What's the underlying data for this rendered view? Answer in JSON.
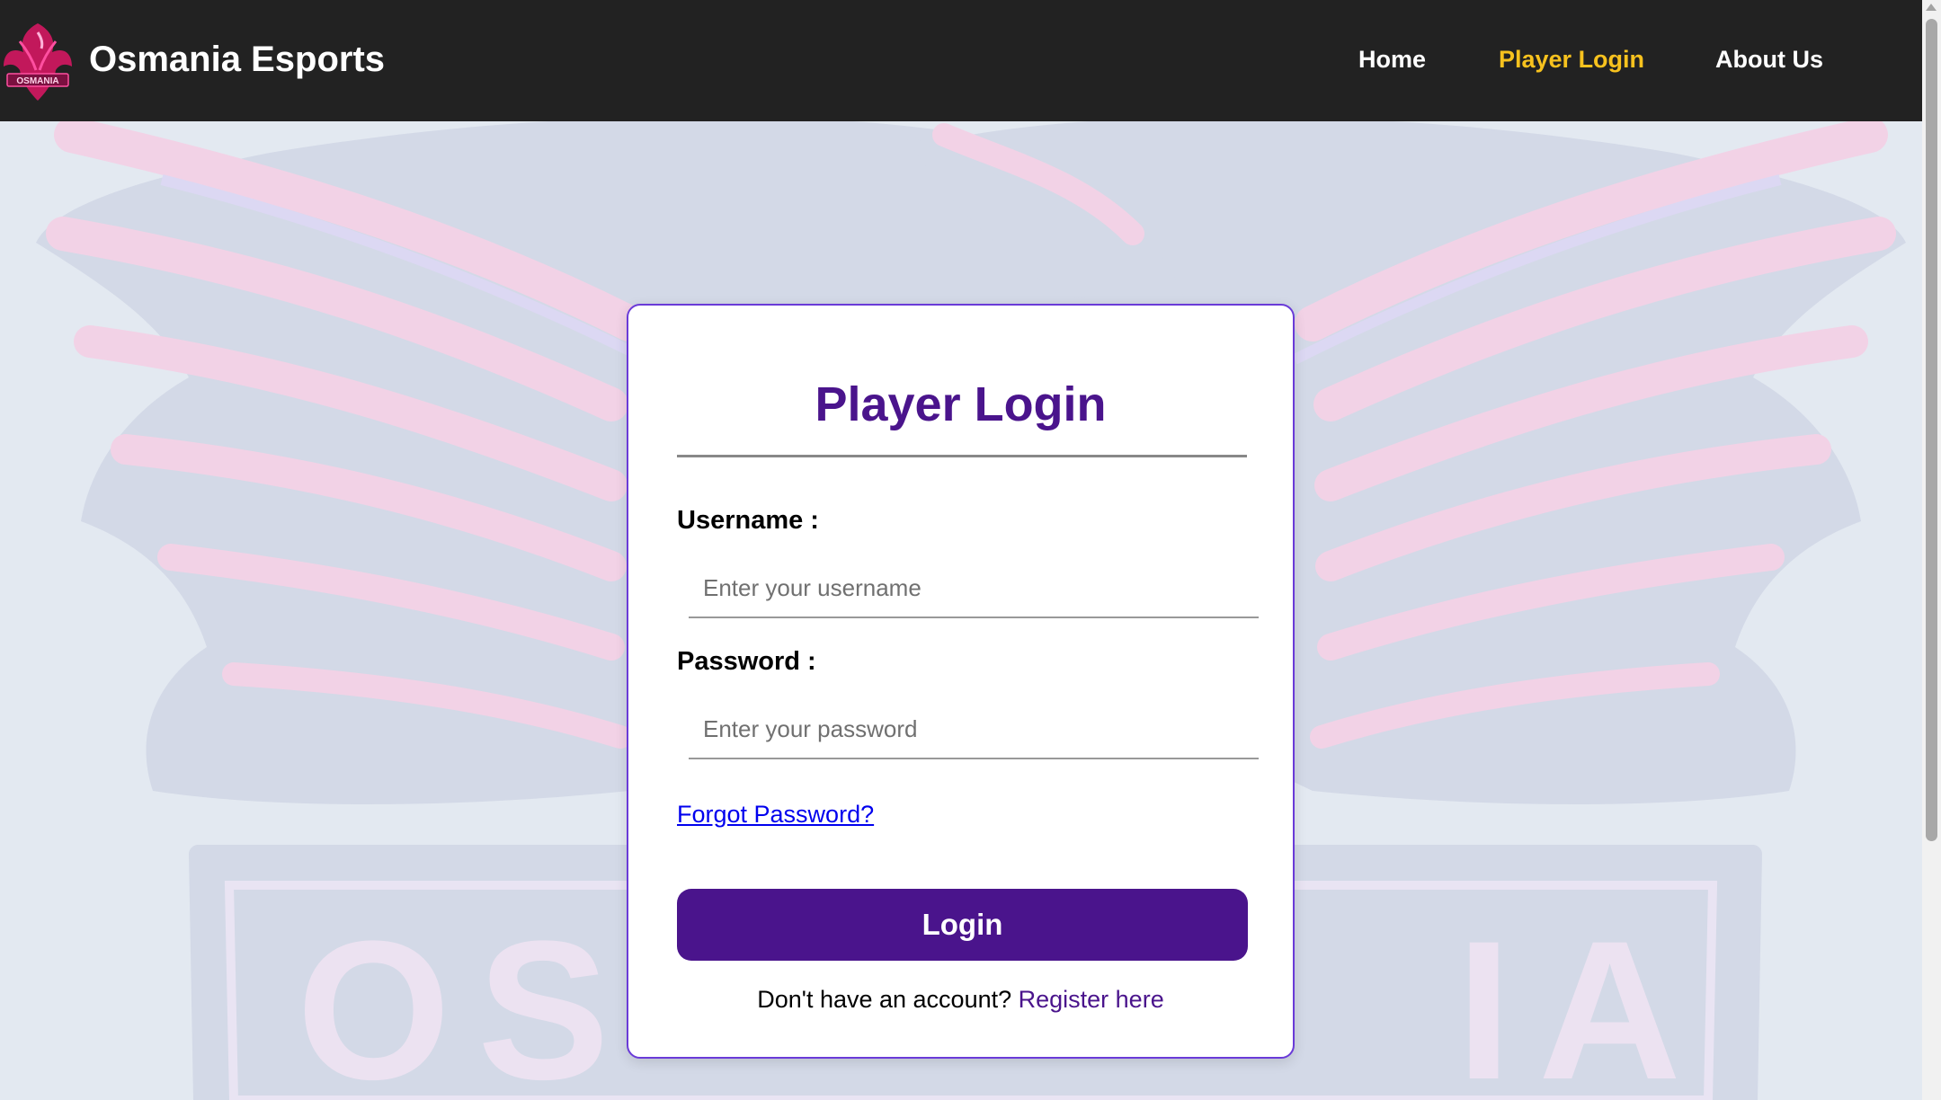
{
  "navbar": {
    "brand_name": "Osmania Esports",
    "logo_text": "OSMANIA",
    "links": [
      {
        "label": "Home"
      },
      {
        "label": "Player Login",
        "active": true
      },
      {
        "label": "About Us"
      }
    ],
    "active_color": "#f7c21e"
  },
  "background": {
    "watermark_text": "OSMANIA",
    "visible_letters_left": "OS",
    "visible_letters_right": "IA"
  },
  "login_card": {
    "title": "Player Login",
    "username_label": "Username :",
    "username_placeholder": "Enter your username",
    "password_label": "Password :",
    "password_placeholder": "Enter your password",
    "forgot_password": "Forgot Password?",
    "login_button": "Login",
    "register_prompt": "Don't have an account?",
    "register_link": "Register here",
    "accent_color": "#4a148c"
  }
}
